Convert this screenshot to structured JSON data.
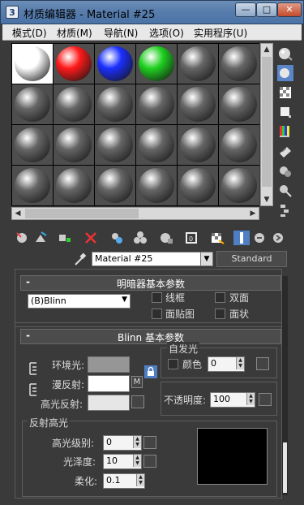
{
  "window": {
    "title": "材质编辑器 - Material #25",
    "min": "—",
    "max": "□",
    "close": "✕"
  },
  "menu": [
    "模式(D)",
    "材质(M)",
    "导航(N)",
    "选项(O)",
    "实用程序(U)"
  ],
  "samples": {
    "colors": [
      "#ffffff",
      "#ff1a1a",
      "#1a2fff",
      "#1fd11f",
      "#666666",
      "#666666"
    ],
    "selected_index": 0
  },
  "material": {
    "name": "Material #25",
    "type": "Standard"
  },
  "shader": {
    "rollout_title": "明暗器基本参数",
    "shader_value": "(B)Blinn",
    "opt_wire": "线框",
    "opt_two_sided": "双面",
    "opt_face_map": "面贴图",
    "opt_faceted": "面状"
  },
  "blinn": {
    "rollout_title": "Blinn 基本参数",
    "ambient": "环境光:",
    "diffuse": "漫反射:",
    "specular": "高光反射:",
    "map_m": "M",
    "self_illum_title": "自发光",
    "color_label": "颜色",
    "self_illum_value": "0",
    "opacity_label": "不透明度:",
    "opacity_value": "100",
    "spec_title": "反射高光",
    "spec_level": "高光级别:",
    "spec_level_value": "0",
    "gloss": "光泽度:",
    "gloss_value": "10",
    "soften": "柔化:",
    "soften_value": "0.1",
    "colors": {
      "ambient": "#969696",
      "diffuse": "#ffffff",
      "specular": "#e6e6e6",
      "curve_bg": "#000000"
    }
  },
  "minus": "-"
}
